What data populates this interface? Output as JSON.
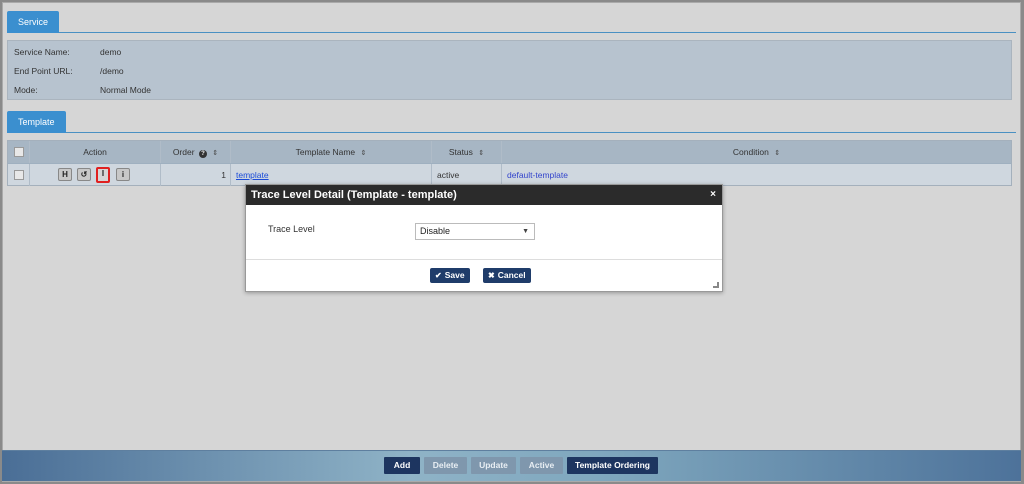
{
  "service_tab": {
    "label": "Service"
  },
  "service": {
    "rows": [
      {
        "label": "Service Name:",
        "value": "demo"
      },
      {
        "label": "End Point URL:",
        "value": "/demo"
      },
      {
        "label": "Mode:",
        "value": "Normal Mode"
      }
    ]
  },
  "template_tab": {
    "label": "Template"
  },
  "grid": {
    "headers": {
      "action": "Action",
      "order": "Order",
      "template_name": "Template Name",
      "status": "Status",
      "condition": "Condition"
    },
    "sort_icon": "sort-icon",
    "rows": [
      {
        "action_buttons": [
          "H",
          "↺",
          "I",
          "i"
        ],
        "order": "1",
        "template_name": "template",
        "status": "active",
        "condition": "default-template"
      }
    ]
  },
  "modal": {
    "title": "Trace Level Detail (Template - template)",
    "close": "×",
    "field_label": "Trace Level",
    "select_value": "Disable",
    "save_label": "Save",
    "cancel_label": "Cancel"
  },
  "footer": {
    "add": "Add",
    "delete": "Delete",
    "update": "Update",
    "active": "Active",
    "template_ordering": "Template Ordering"
  },
  "colors": {
    "tab_blue": "#3b8fcf",
    "primary_button": "#1d3560",
    "highlight": "#e02020"
  }
}
